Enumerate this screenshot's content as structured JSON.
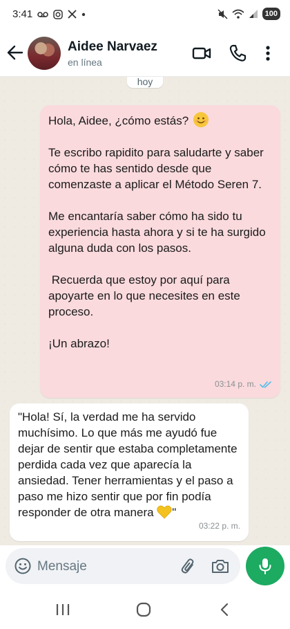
{
  "status_bar": {
    "time": "3:41",
    "battery": "100",
    "icons": [
      "voicemail-icon",
      "instagram-icon",
      "x-icon",
      "dot-icon",
      "mute-icon",
      "wifi-icon",
      "signal-icon",
      "battery-icon"
    ]
  },
  "header": {
    "contact_name": "Aidee Narvaez",
    "contact_status": "en línea",
    "icons": [
      "back-arrow-icon",
      "video-call-icon",
      "phone-icon",
      "more-vert-icon"
    ]
  },
  "chat": {
    "date_chip": "hoy",
    "outgoing": {
      "paragraphs": [
        "Hola, Aidee, ¿cómo estás?",
        "Te escribo rapidito para saludarte y saber cómo te has sentido desde que comenzaste a aplicar el Método Seren 7.",
        "Me encantaría saber cómo ha sido tu experiencia hasta ahora y si te ha surgido alguna duda con los pasos.",
        " Recuerda que estoy por aquí para apoyarte en lo que necesites en este proceso.",
        "¡Un abrazo!"
      ],
      "time": "03:14 p. m.",
      "ticks": "double-check-icon"
    },
    "incoming": {
      "text": "\"Hola! Sí, la verdad me ha servido muchísimo. Lo que más me ayudó fue dejar de sentir que estaba completamente perdida cada vez que aparecía la ansiedad. Tener herramientas y el paso a paso me hizo sentir que por fin podía responder de otra manera",
      "text_end": "\"",
      "time": "03:22 p. m."
    }
  },
  "composer": {
    "placeholder": "Mensaje",
    "icons": [
      "emoji-icon",
      "attach-icon",
      "camera-icon",
      "mic-icon"
    ]
  },
  "colors": {
    "outgoing_bubble": "#fadadd",
    "incoming_bubble": "#ffffff",
    "chat_background": "#efeae2",
    "mic_button": "#1daa61",
    "read_ticks": "#53bdeb"
  }
}
